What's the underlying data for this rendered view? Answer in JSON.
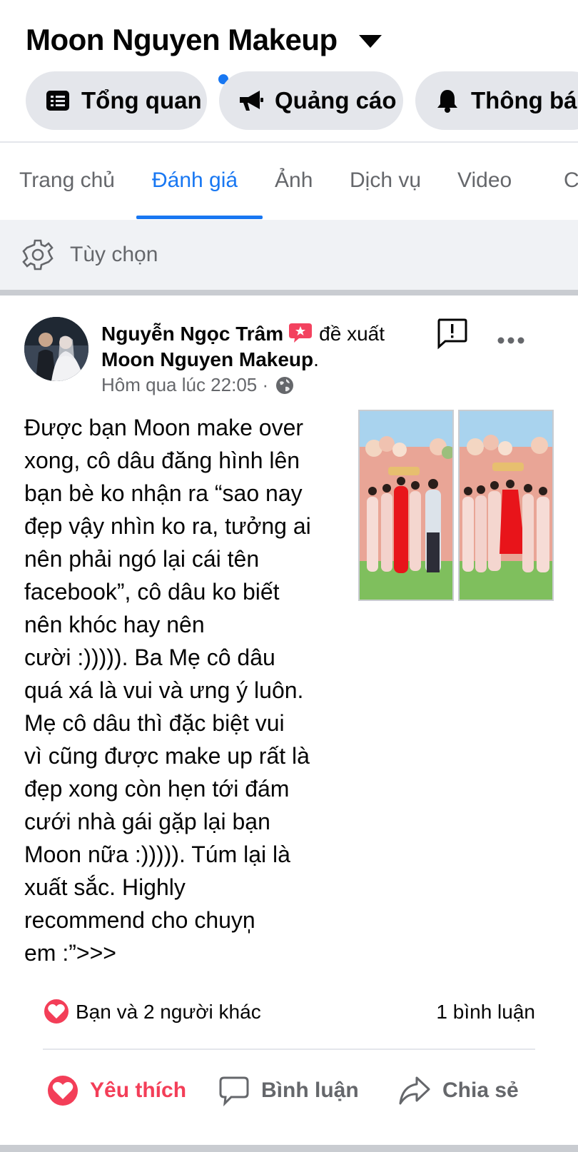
{
  "header": {
    "page_title": "Moon Nguyen Makeup",
    "pills": [
      {
        "label": "Tổng quan",
        "icon": "dashboard-icon"
      },
      {
        "label": "Quảng cáo",
        "icon": "megaphone-icon"
      },
      {
        "label": "Thông bá",
        "icon": "bell-icon"
      }
    ]
  },
  "tabs": [
    {
      "label": "Trang chủ"
    },
    {
      "label": "Đánh giá"
    },
    {
      "label": "Ảnh"
    },
    {
      "label": "Dịch vụ"
    },
    {
      "label": "Video"
    },
    {
      "label": "C"
    }
  ],
  "options": {
    "label": "Tùy chọn"
  },
  "post": {
    "author": "Nguyễn Ngọc Trâm",
    "verb": "đề xuất",
    "page": "Moon Nguyen Makeup",
    "page_suffix": ".",
    "time": "Hôm qua lúc 22:05 ·",
    "body_lines": [
      "Được bạn Moon make over",
      "xong, cô dâu đăng hình lên",
      "bạn bè ko nhận ra “sao nay",
      "đẹp vậy nhìn ko ra, tưởng ai",
      "nên phải ngó lại cái tên",
      "facebook”, cô dâu ko biết",
      "nên khóc hay nên",
      "cười :))))). Ba Mẹ cô dâu",
      "quá xá là vui và ưng ý luôn.",
      "Mẹ cô dâu thì đặc biệt vui",
      "vì cũng được make up rất là",
      "đẹp xong còn hẹn tới đám",
      "cưới nhà gái gặp lại bạn",
      "Moon nữa :))))). Túm lại là",
      "xuất sắc. Highly",
      "recommend cho chuyn̩",
      "em :”>>>"
    ],
    "reactions_text": "Bạn và 2 người khác",
    "comments_text": "1 bình luận",
    "actions": {
      "like": "Yêu thích",
      "comment": "Bình luận",
      "share": "Chia sẻ"
    }
  },
  "colors": {
    "accent": "#1877f2",
    "love": "#f33e58",
    "secondary_text": "#65676b",
    "pill_bg": "#e4e6eb"
  }
}
